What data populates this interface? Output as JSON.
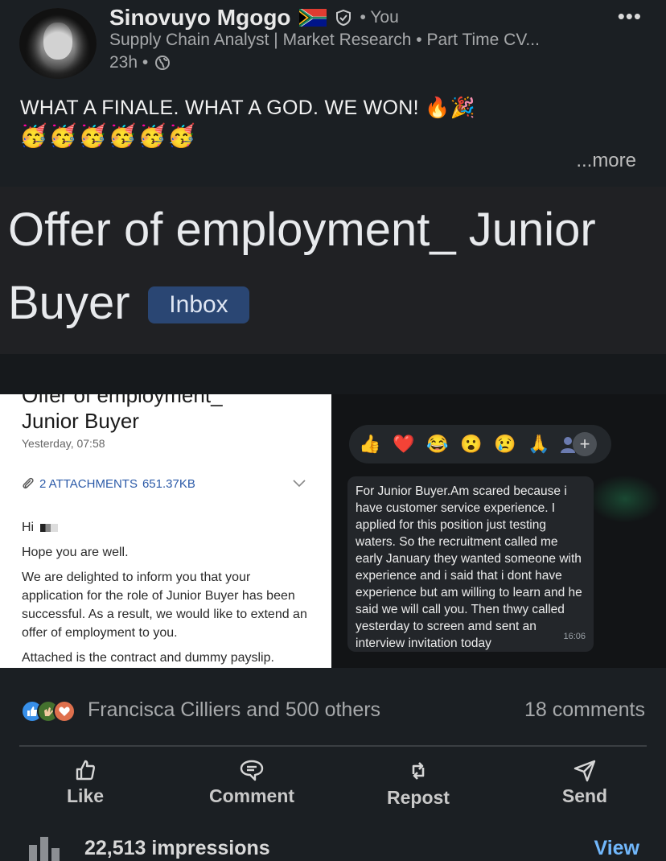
{
  "post": {
    "author_name": "Sinovuyo Mgogo",
    "author_relation": "• You",
    "headline": "Supply Chain Analyst | Market Research • Part Time CV...",
    "time": "23h •",
    "text": "WHAT A FINALE. WHAT A GOD. WE WON! 🔥🎉",
    "emojis": "🥳🥳🥳🥳🥳🥳",
    "see_more": "...more",
    "more_options": "•••"
  },
  "image": {
    "subject_line1": "Offer of employment_ Junior",
    "subject_line2": "Buyer",
    "inbox_label": "Inbox",
    "email": {
      "cut_title": "Offer of employment_",
      "title": "Junior Buyer",
      "date": "Yesterday, 07:58",
      "attachments": "2 ATTACHMENTS",
      "attachments_size": "651.37KB",
      "greeting": "Hi",
      "line1": "Hope you are well.",
      "paragraph": "We are delighted to inform you that your application for the role of Junior Buyer has been successful.  As a result, we would like to extend an offer of employment to you.",
      "line_last": "Attached is the contract and dummy payslip."
    },
    "chat": {
      "reactions": [
        "👍",
        "❤️",
        "😂",
        "😮",
        "😢",
        "🙏"
      ],
      "plus": "+",
      "message": "For Junior Buyer.Am scared because i have customer service experience. I applied for this position just testing waters. So the recruitment called me early January they wanted someone with experience and i said that i dont have experience but am willing to learn and he said we will call you. Then thwy called yesterday to screen amd sent an interview  invitation today",
      "time": "16:06"
    }
  },
  "social": {
    "reactors": "Francisca Cilliers and 500 others",
    "comments": "18 comments",
    "actions": {
      "like": "Like",
      "comment": "Comment",
      "repost": "Repost",
      "send": "Send"
    },
    "impressions": "22,513 impressions",
    "view": "View"
  },
  "colors": {
    "background": "#1b1f23",
    "link": "#71b7fb",
    "inbox_chip": "#2a4673"
  }
}
